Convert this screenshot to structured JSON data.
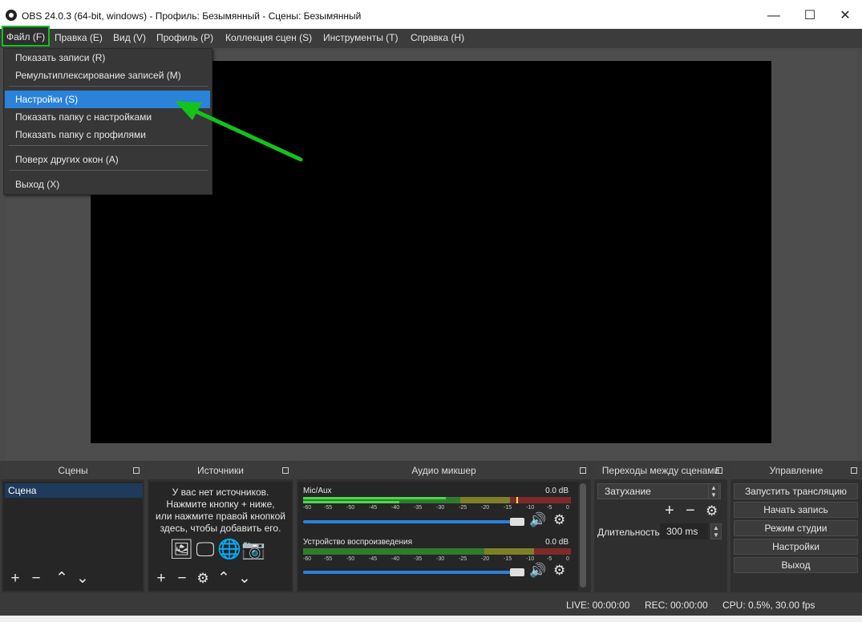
{
  "window": {
    "title": "OBS 24.0.3 (64-bit, windows) - Профиль: Безымянный - Сцены: Безымянный",
    "minimize": "—",
    "maximize": "☐",
    "close": "✕"
  },
  "menubar": {
    "items": [
      "Файл (F)",
      "Правка (E)",
      "Вид (V)",
      "Профиль (P)",
      "Коллекция сцен (S)",
      "Инструменты (T)",
      "Справка (H)"
    ],
    "active_index": 0
  },
  "file_menu": {
    "items": [
      "Показать записи (R)",
      "Ремультиплексирование записей (M)",
      "Настройки (S)",
      "Показать папку с настройками",
      "Показать папку с профилями",
      "Поверх других окон (A)",
      "Выход (X)"
    ],
    "highlighted_index": 2
  },
  "docks": {
    "scenes": {
      "title": "Сцены",
      "items": [
        "Сцена"
      ]
    },
    "sources": {
      "title": "Источники",
      "empty_hint": [
        "У вас нет источников.",
        "Нажмите кнопку + ниже,",
        "или нажмите правой кнопкой",
        "здесь, чтобы добавить его."
      ]
    },
    "mixer": {
      "title": "Аудио микшер",
      "scale": [
        "-60",
        "-55",
        "-50",
        "-45",
        "-40",
        "-35",
        "-30",
        "-25",
        "-20",
        "-15",
        "-10",
        "-5",
        "0"
      ],
      "channels": [
        {
          "name": "Mic/Aux",
          "db": "0.0 dB"
        },
        {
          "name": "Устройство воспроизведения",
          "db": "0.0 dB"
        }
      ]
    },
    "transitions": {
      "title": "Переходы между сценами",
      "selected": "Затухание",
      "duration_label": "Длительность",
      "duration_value": "300 ms"
    },
    "controls": {
      "title": "Управление",
      "buttons": [
        "Запустить трансляцию",
        "Начать запись",
        "Режим студии",
        "Настройки",
        "Выход"
      ]
    }
  },
  "status": {
    "live": "LIVE: 00:00:00",
    "rec": "REC: 00:00:00",
    "cpu": "CPU: 0.5%, 30.00 fps"
  },
  "colors": {
    "highlight": "#2a82da",
    "annotation": "#13c31c",
    "preview": "#000000"
  }
}
